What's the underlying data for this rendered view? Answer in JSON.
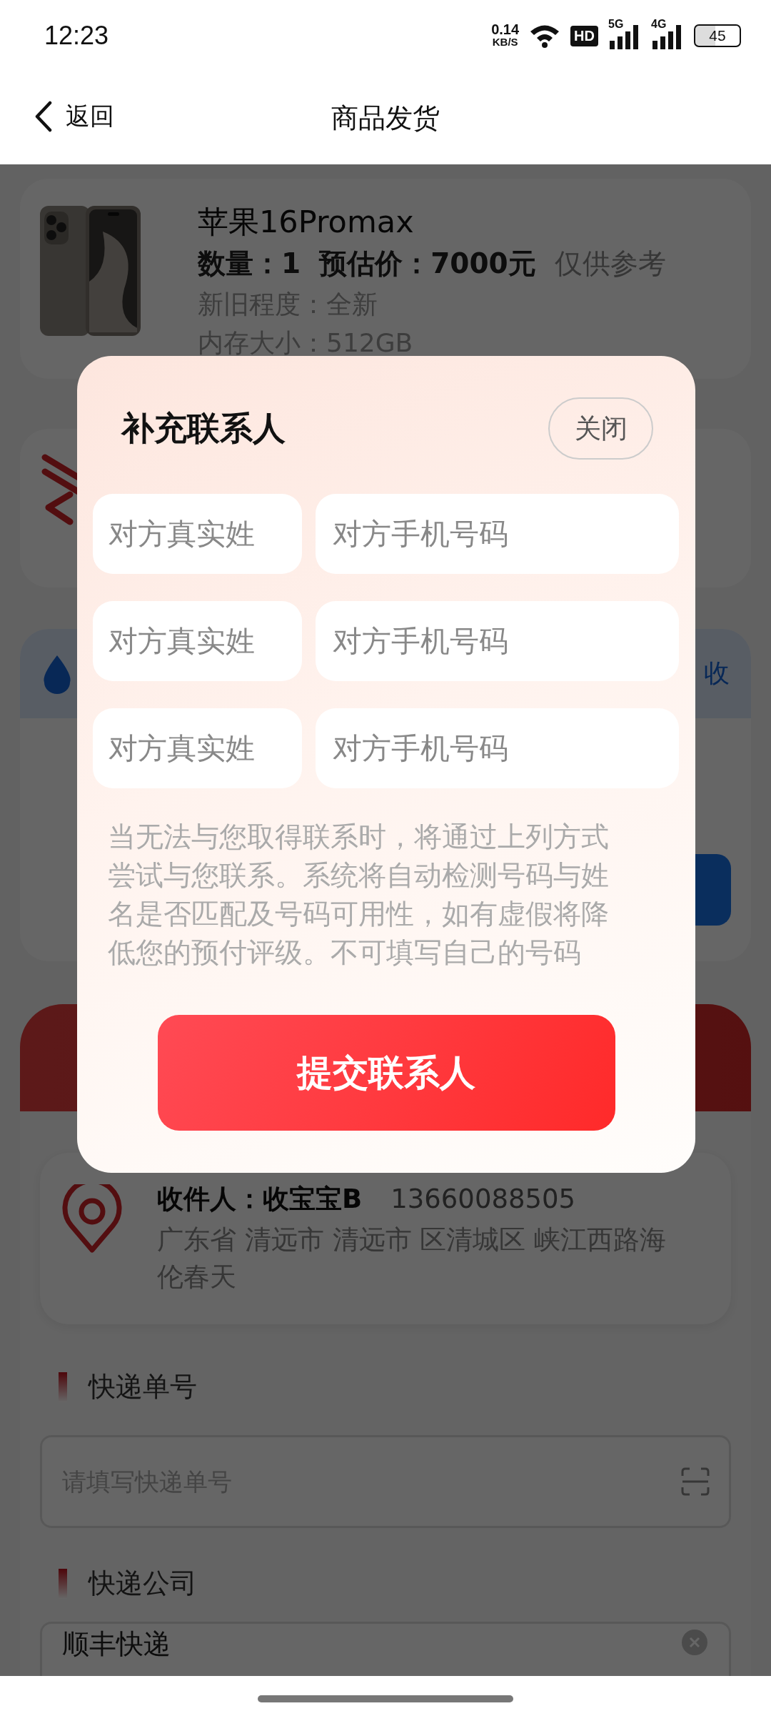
{
  "status_bar": {
    "time": "12:23",
    "net_speed": "0.14",
    "net_unit": "KB/S",
    "hd": "HD",
    "signals": [
      "5G",
      "4G"
    ],
    "battery": "45"
  },
  "nav": {
    "back": "返回",
    "title": "商品发货"
  },
  "product": {
    "name": "苹果16Promax",
    "qty_label": "数量：",
    "qty": "1",
    "price_label": "预估价：",
    "price": "7000元",
    "price_note": "仅供参考",
    "specs": [
      "新旧程度：全新",
      "内存大小：512GB"
    ]
  },
  "service_card": {
    "link_fragment": "收"
  },
  "address": {
    "receiver": "收件人：收宝宝B",
    "phone": "13660088505",
    "detail": "广东省 清远市 清远市 区清城区 峡江西路海伦春天"
  },
  "tracking": {
    "title": "快递单号",
    "placeholder": "请填写快递单号"
  },
  "courier": {
    "title": "快递公司",
    "value": "顺丰快递"
  },
  "modal": {
    "title": "补充联系人",
    "close": "关闭",
    "contacts": [
      {
        "name_placeholder": "对方真实姓",
        "phone_placeholder": "对方手机号码"
      },
      {
        "name_placeholder": "对方真实姓",
        "phone_placeholder": "对方手机号码"
      },
      {
        "name_placeholder": "对方真实姓",
        "phone_placeholder": "对方手机号码"
      }
    ],
    "notice": "当无法与您取得联系时，将通过上列方式尝试与您联系。系统将自动检测号码与姓名是否匹配及号码可用性，如有虚假将降低您的预付评级。不可填写自己的号码",
    "submit": "提交联系人"
  }
}
